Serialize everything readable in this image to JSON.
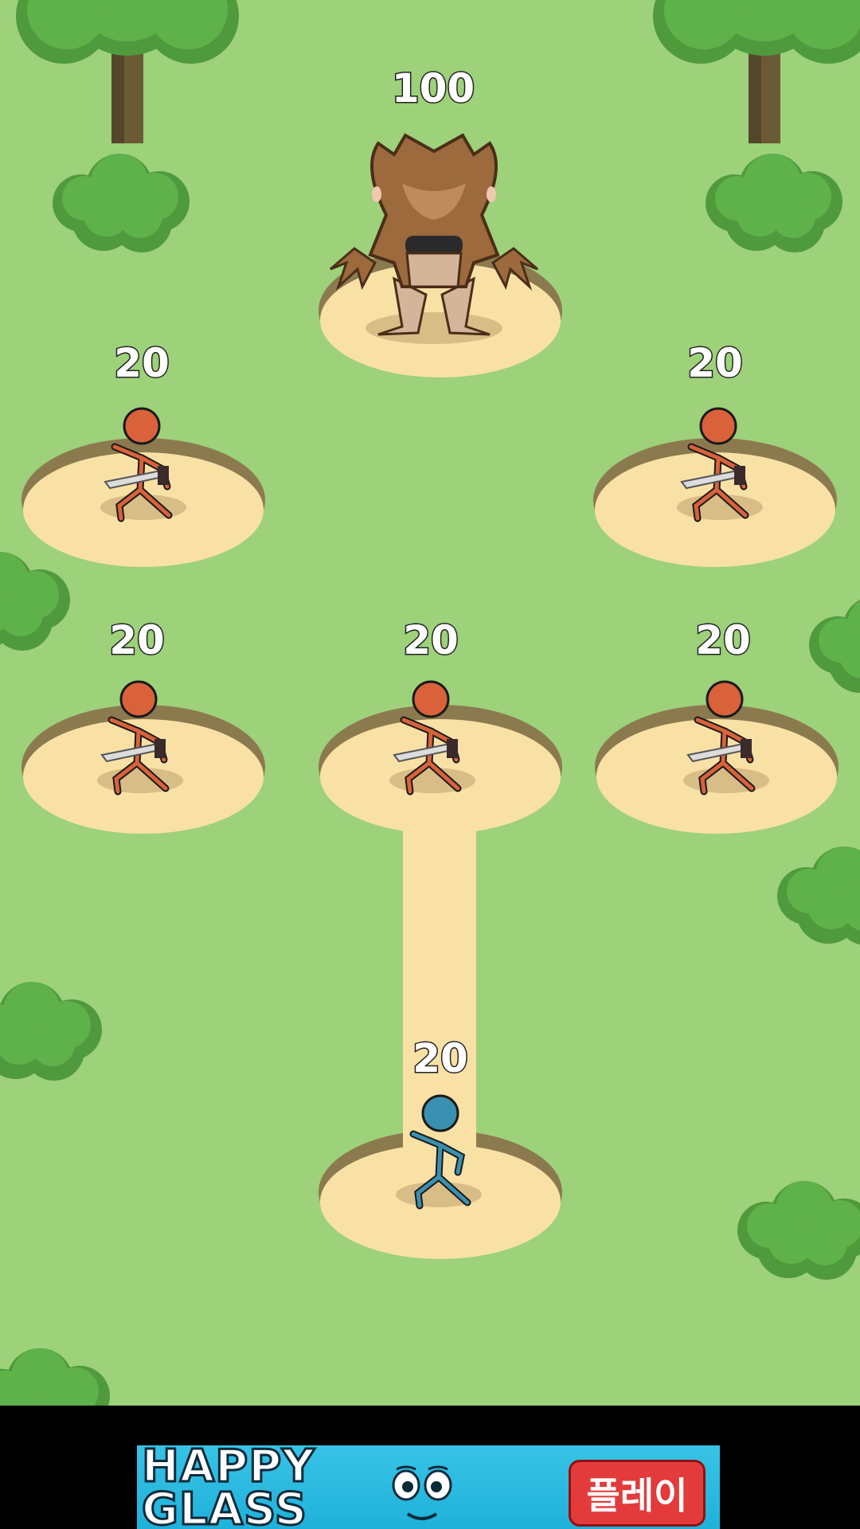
{
  "boss": {
    "name_icon": "werewolf-icon",
    "power": "100"
  },
  "enemies": [
    {
      "id": "enemy-1",
      "power": "20"
    },
    {
      "id": "enemy-2",
      "power": "20"
    },
    {
      "id": "enemy-3",
      "power": "20"
    },
    {
      "id": "enemy-4",
      "power": "20"
    },
    {
      "id": "enemy-5",
      "power": "20"
    }
  ],
  "player": {
    "power": "20",
    "color": "#3a90b0"
  },
  "colors": {
    "grass": "#9dd17a",
    "platform": "#f9e1a6",
    "platform_rim": "#8c7a4f",
    "enemy": "#d9623a",
    "player": "#3a90b0"
  },
  "ad": {
    "title": "HAPPY GLASS",
    "play_label": "플레이"
  }
}
